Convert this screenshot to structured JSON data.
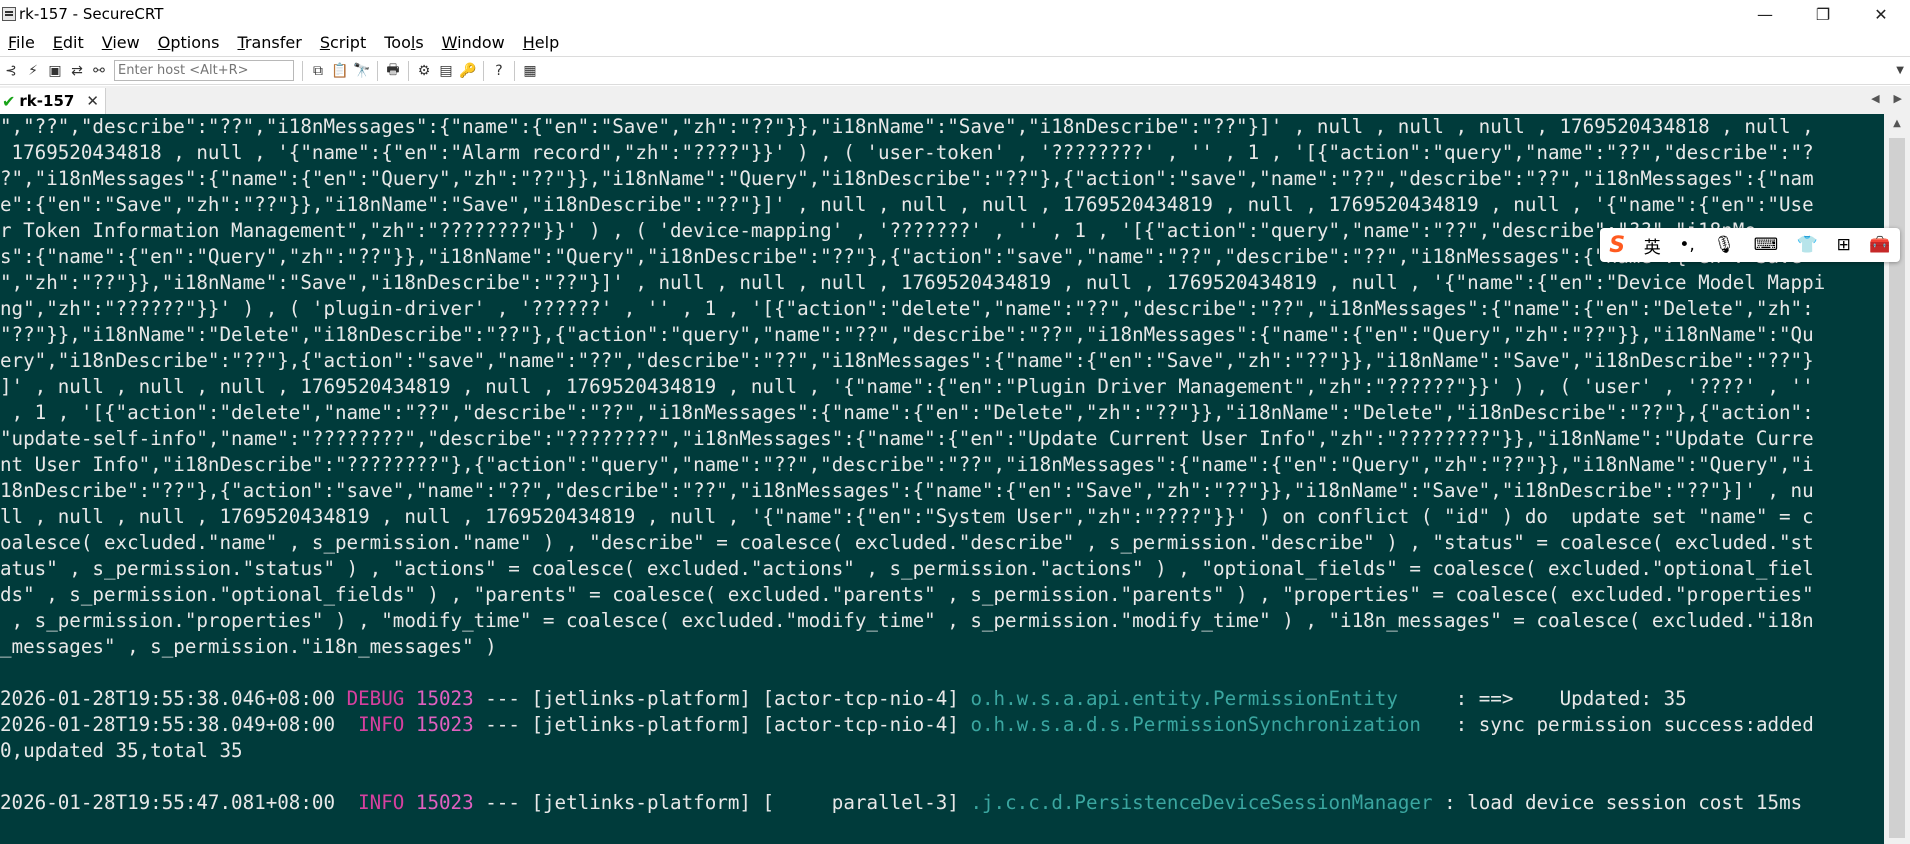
{
  "window": {
    "title": "rk-157 - SecureCRT",
    "minimize": "—",
    "maximize": "❐",
    "close": "✕"
  },
  "menu": [
    {
      "label": "File",
      "key": "F",
      "rest": "ile"
    },
    {
      "label": "Edit",
      "key": "E",
      "rest": "dit"
    },
    {
      "label": "View",
      "key": "V",
      "rest": "iew"
    },
    {
      "label": "Options",
      "key": "O",
      "rest": "ptions"
    },
    {
      "label": "Transfer",
      "key": "T",
      "rest": "ransfer"
    },
    {
      "label": "Script",
      "key": "S",
      "rest": "cript"
    },
    {
      "label": "Tools",
      "key": "l",
      "pre": "Too",
      "rest": "s"
    },
    {
      "label": "Window",
      "key": "W",
      "rest": "indow"
    },
    {
      "label": "Help",
      "key": "H",
      "rest": "elp"
    }
  ],
  "toolbar": {
    "host_placeholder": "Enter host <Alt+R>"
  },
  "tab": {
    "label": "rk-157",
    "status_icon": "check-icon"
  },
  "terminal": {
    "lines": [
      "\",\"??\",\"describe\":\"??\",\"i18nMessages\":{\"name\":{\"en\":\"Save\",\"zh\":\"??\"}},\"i18nName\":\"Save\",\"i18nDescribe\":\"??\"}]' , null , null , null , 1769520434818 , null ,",
      " 1769520434818 , null , '{\"name\":{\"en\":\"Alarm record\",\"zh\":\"????\"}}' ) , ( 'user-token' , '????????' , '' , 1 , '[{\"action\":\"query\",\"name\":\"??\",\"describe\":\"?",
      "?\",\"i18nMessages\":{\"name\":{\"en\":\"Query\",\"zh\":\"??\"}},\"i18nName\":\"Query\",\"i18nDescribe\":\"??\"},{\"action\":\"save\",\"name\":\"??\",\"describe\":\"??\",\"i18nMessages\":{\"nam",
      "e\":{\"en\":\"Save\",\"zh\":\"??\"}},\"i18nName\":\"Save\",\"i18nDescribe\":\"??\"}]' , null , null , null , 1769520434819 , null , 1769520434819 , null , '{\"name\":{\"en\":\"Use",
      "r Token Information Management\",\"zh\":\"????????\"}}' ) , ( 'device-mapping' , '???????' , '' , 1 , '[{\"action\":\"query\",\"name\":\"??\",\"describe\":\"??\",\"i18nMe",
      "s\":{\"name\":{\"en\":\"Query\",\"zh\":\"??\"}},\"i18nName\":\"Query\",\"i18nDescribe\":\"??\"},{\"action\":\"save\",\"name\":\"??\",\"describe\":\"??\",\"i18nMessages\":{\"name\":{\"en\":\"Save",
      "\",\"zh\":\"??\"}},\"i18nName\":\"Save\",\"i18nDescribe\":\"??\"}]' , null , null , null , 1769520434819 , null , 1769520434819 , null , '{\"name\":{\"en\":\"Device Model Mappi",
      "ng\",\"zh\":\"??????\"}}' ) , ( 'plugin-driver' , '??????' , '' , 1 , '[{\"action\":\"delete\",\"name\":\"??\",\"describe\":\"??\",\"i18nMessages\":{\"name\":{\"en\":\"Delete\",\"zh\":",
      "\"??\"}},\"i18nName\":\"Delete\",\"i18nDescribe\":\"??\"},{\"action\":\"query\",\"name\":\"??\",\"describe\":\"??\",\"i18nMessages\":{\"name\":{\"en\":\"Query\",\"zh\":\"??\"}},\"i18nName\":\"Qu",
      "ery\",\"i18nDescribe\":\"??\"},{\"action\":\"save\",\"name\":\"??\",\"describe\":\"??\",\"i18nMessages\":{\"name\":{\"en\":\"Save\",\"zh\":\"??\"}},\"i18nName\":\"Save\",\"i18nDescribe\":\"??\"}",
      "]' , null , null , null , 1769520434819 , null , 1769520434819 , null , '{\"name\":{\"en\":\"Plugin Driver Management\",\"zh\":\"??????\"}}' ) , ( 'user' , '????' , ''",
      " , 1 , '[{\"action\":\"delete\",\"name\":\"??\",\"describe\":\"??\",\"i18nMessages\":{\"name\":{\"en\":\"Delete\",\"zh\":\"??\"}},\"i18nName\":\"Delete\",\"i18nDescribe\":\"??\"},{\"action\":",
      "\"update-self-info\",\"name\":\"????????\",\"describe\":\"????????\",\"i18nMessages\":{\"name\":{\"en\":\"Update Current User Info\",\"zh\":\"????????\"}},\"i18nName\":\"Update Curre",
      "nt User Info\",\"i18nDescribe\":\"????????\"},{\"action\":\"query\",\"name\":\"??\",\"describe\":\"??\",\"i18nMessages\":{\"name\":{\"en\":\"Query\",\"zh\":\"??\"}},\"i18nName\":\"Query\",\"i",
      "18nDescribe\":\"??\"},{\"action\":\"save\",\"name\":\"??\",\"describe\":\"??\",\"i18nMessages\":{\"name\":{\"en\":\"Save\",\"zh\":\"??\"}},\"i18nName\":\"Save\",\"i18nDescribe\":\"??\"}]' , nu",
      "ll , null , null , 1769520434819 , null , 1769520434819 , null , '{\"name\":{\"en\":\"System User\",\"zh\":\"????\"}}' ) on conflict ( \"id\" ) do  update set \"name\" = c",
      "oalesce( excluded.\"name\" , s_permission.\"name\" ) , \"describe\" = coalesce( excluded.\"describe\" , s_permission.\"describe\" ) , \"status\" = coalesce( excluded.\"st",
      "atus\" , s_permission.\"status\" ) , \"actions\" = coalesce( excluded.\"actions\" , s_permission.\"actions\" ) , \"optional_fields\" = coalesce( excluded.\"optional_fiel",
      "ds\" , s_permission.\"optional_fields\" ) , \"parents\" = coalesce( excluded.\"parents\" , s_permission.\"parents\" ) , \"properties\" = coalesce( excluded.\"properties\"",
      " , s_permission.\"properties\" ) , \"modify_time\" = coalesce( excluded.\"modify_time\" , s_permission.\"modify_time\" ) , \"i18n_messages\" = coalesce( excluded.\"i18n",
      "_messages\" , s_permission.\"i18n_messages\" )"
    ],
    "logs": [
      {
        "ts": "2026-01-28T19:55:38.046+08:00",
        "level": "DEBUG",
        "pid": "15023",
        "sep": " --- ",
        "app": "[jetlinks-platform]",
        "thread": "[actor-tcp-nio-4]",
        "logger": "o.h.w.s.a.api.entity.PermissionEntity    ",
        "msg": " : ==>    Updated: 35"
      },
      {
        "ts": "2026-01-28T19:55:38.049+08:00",
        "level": " INFO",
        "pid": "15023",
        "sep": " --- ",
        "app": "[jetlinks-platform]",
        "thread": "[actor-tcp-nio-4]",
        "logger": "o.h.w.s.a.d.s.PermissionSynchronization  ",
        "msg": " : sync permission success:added"
      },
      {
        "plain": "0,updated 35,total 35"
      },
      {
        "ts": "",
        "plain": ""
      },
      {
        "ts": "2026-01-28T19:55:47.081+08:00",
        "level": " INFO",
        "pid": "15023",
        "sep": " --- ",
        "app": "[jetlinks-platform]",
        "thread": "[     parallel-3]",
        "logger": ".j.c.c.d.PersistenceDeviceSessionManager",
        "msg": " : load device session cost 15ms"
      }
    ]
  },
  "ime": {
    "logo": "S",
    "lang": "英",
    "punct": "•,",
    "mic": "🎙",
    "keyboard": "⌨",
    "skin": "👕",
    "grid": "⊞",
    "tools": "🧰"
  },
  "colors": {
    "terminal_bg": "#003b3b",
    "terminal_fg": "#e8e8e8",
    "level": "#d6409f",
    "logger": "#3aa6a0",
    "check": "#19a319"
  }
}
